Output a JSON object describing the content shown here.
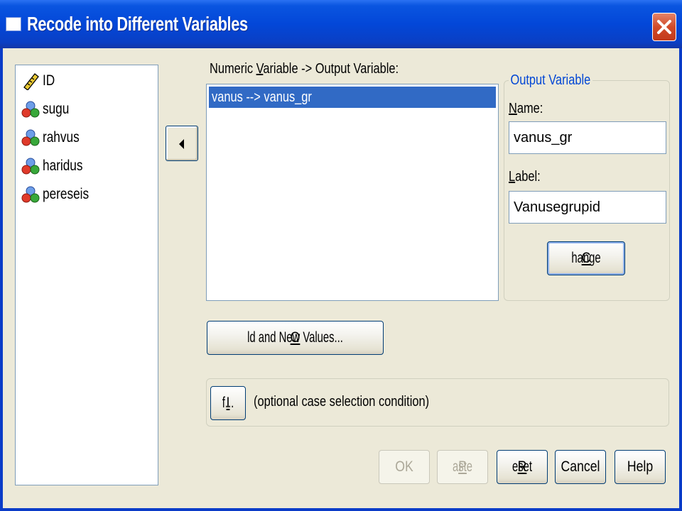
{
  "window": {
    "title": "Recode into Different Variables"
  },
  "variables": [
    {
      "name": "ID",
      "icon": "scale-ruler-icon"
    },
    {
      "name": "sugu",
      "icon": "nominal-icon"
    },
    {
      "name": "rahvus",
      "icon": "nominal-icon"
    },
    {
      "name": "haridus",
      "icon": "nominal-icon"
    },
    {
      "name": "pereseis",
      "icon": "nominal-icon"
    }
  ],
  "mapping": {
    "label_pre": "Numeric ",
    "label_key": "V",
    "label_post": "ariable -> Output Variable:",
    "items": [
      "vanus --> vanus_gr"
    ]
  },
  "output_variable": {
    "legend": "Output Variable",
    "name_key": "N",
    "name_rest": "ame:",
    "name_value": "vanus_gr",
    "label_key": "L",
    "label_rest": "abel:",
    "label_value": "Vanusegrupid",
    "change_key": "C",
    "change_rest": "hange"
  },
  "old_new_values": {
    "key": "O",
    "rest": "ld and New Values..."
  },
  "condition": {
    "if_key": "I",
    "if_rest": "f...",
    "text": "(optional case selection condition)"
  },
  "footer": {
    "ok": "OK",
    "paste_key": "P",
    "paste_rest": "aste",
    "reset_key": "R",
    "reset_rest": "eset",
    "cancel": "Cancel",
    "help": "Help"
  },
  "colors": {
    "title_bar": "#0347d8",
    "selection": "#316ac5",
    "group_legend": "#0046d5",
    "close": "#d24a28"
  }
}
